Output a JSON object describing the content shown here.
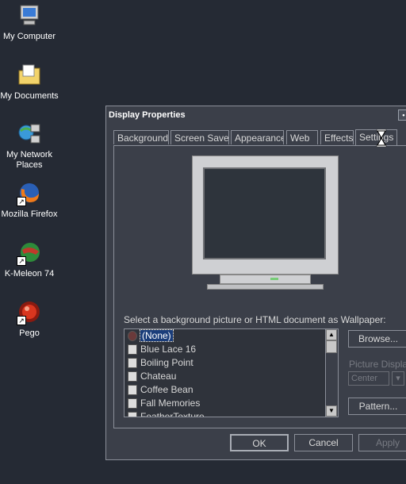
{
  "desktop": {
    "icons": [
      {
        "label": "My Computer",
        "icon": "my-computer-icon"
      },
      {
        "label": "My Documents",
        "icon": "my-documents-icon"
      },
      {
        "label_line1": "My Network",
        "label_line2": "Places",
        "icon": "network-places-icon"
      },
      {
        "label": "Mozilla Firefox",
        "icon": "firefox-icon"
      },
      {
        "label": "K-Meleon 74",
        "icon": "kmeleon-icon"
      },
      {
        "label": "Pego",
        "icon": "pego-icon"
      }
    ]
  },
  "window": {
    "title": "Display Properties",
    "tabs": [
      "Background",
      "Screen Saver",
      "Appearance",
      "Web",
      "Effects",
      "Settings"
    ],
    "active_tab": "Settings",
    "wallpaper_label": "Select a background picture or HTML document as Wallpaper:",
    "wallpapers": [
      "(None)",
      "Blue Lace 16",
      "Boiling Point",
      "Chateau",
      "Coffee Bean",
      "Fall Memories",
      "FeatherTexture"
    ],
    "selected_wallpaper": "(None)",
    "browse_button": "Browse...",
    "picture_display_label": "Picture Display:",
    "picture_display_value": "Center",
    "pattern_button": "Pattern...",
    "ok_button": "OK",
    "cancel_button": "Cancel",
    "apply_button": "Apply"
  },
  "colors": {
    "desktop": "#252a34",
    "window": "#3b3f49",
    "selection": "#1a3d7a"
  }
}
